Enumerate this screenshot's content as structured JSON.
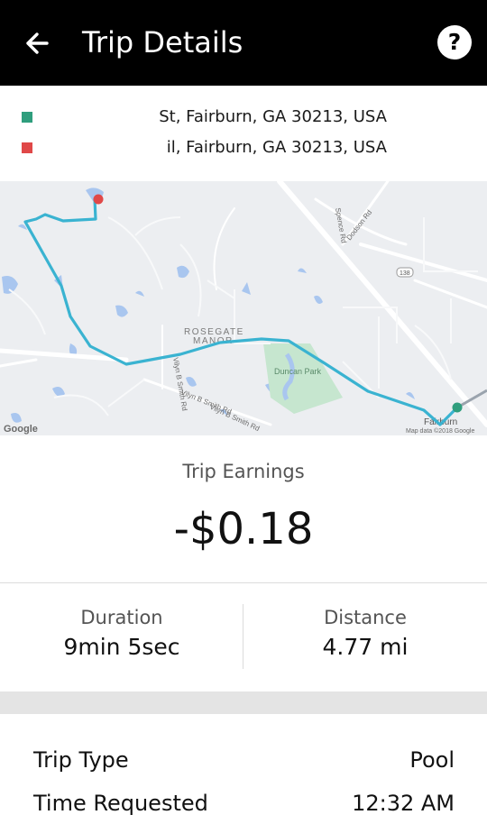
{
  "header": {
    "title": "Trip Details",
    "back_icon": "arrow-left-icon",
    "help_icon": "question-circle-icon",
    "help_label": "?"
  },
  "addresses": {
    "pickup": {
      "text": "St, Fairburn, GA 30213, USA",
      "marker_color": "#2f9e7d"
    },
    "dropoff": {
      "text": "il, Fairburn, GA 30213, USA",
      "marker_color": "#e04848"
    }
  },
  "map": {
    "route_color": "#3ab3d1",
    "labels": {
      "neighborhood_line1": "ROSEGATE",
      "neighborhood_line2": "MANOR",
      "park": "Duncan Park",
      "road_dodson": "Dodson Rd",
      "road_spence": "Spence Rd",
      "road_138": "138",
      "road_vilyn_1": "Vilyn B Smith Rd",
      "road_vilyn_2": "Vilyn B Smith Rd",
      "road_vilyn_3": "Vilyn B Smith Rd",
      "town": "Fairburn",
      "attribution": "Map data ©2018 Google",
      "logo": "Google"
    }
  },
  "earnings": {
    "label": "Trip Earnings",
    "value": "-$0.18"
  },
  "stats": {
    "duration_label": "Duration",
    "duration_value": "9min 5sec",
    "distance_label": "Distance",
    "distance_value": "4.77 mi"
  },
  "details": {
    "trip_type_label": "Trip Type",
    "trip_type_value": "Pool",
    "time_requested_label": "Time Requested",
    "time_requested_value": "12:32 AM"
  }
}
